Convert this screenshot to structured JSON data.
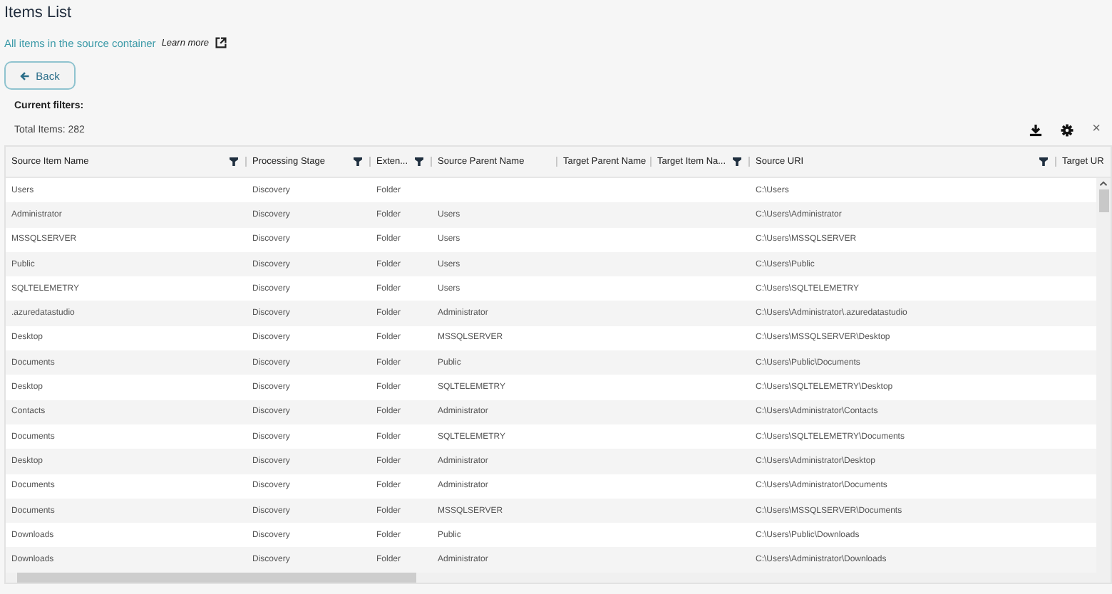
{
  "page": {
    "title": "Items List",
    "subtitle": "All items in the source container",
    "learn_more": "Learn more",
    "back_button": "Back",
    "filters_label": "Current filters:",
    "total_items": "Total Items: 282"
  },
  "toolbar": {
    "close": "×"
  },
  "table": {
    "columns": [
      {
        "label": "Source Item Name",
        "filterable": true
      },
      {
        "label": "Processing Stage",
        "filterable": true
      },
      {
        "label": "Exten...",
        "filterable": true
      },
      {
        "label": "Source Parent Name",
        "filterable": false
      },
      {
        "label": "Target Parent Name",
        "filterable": false
      },
      {
        "label": "Target Item Na...",
        "filterable": true
      },
      {
        "label": "Source URI",
        "filterable": true
      },
      {
        "label": "Target UR",
        "filterable": false
      }
    ],
    "rows": [
      [
        "Users",
        "Discovery",
        "Folder",
        "",
        "",
        "",
        "C:\\Users"
      ],
      [
        "Administrator",
        "Discovery",
        "Folder",
        "Users",
        "",
        "",
        "C:\\Users\\Administrator"
      ],
      [
        "MSSQLSERVER",
        "Discovery",
        "Folder",
        "Users",
        "",
        "",
        "C:\\Users\\MSSQLSERVER"
      ],
      [
        "Public",
        "Discovery",
        "Folder",
        "Users",
        "",
        "",
        "C:\\Users\\Public"
      ],
      [
        "SQLTELEMETRY",
        "Discovery",
        "Folder",
        "Users",
        "",
        "",
        "C:\\Users\\SQLTELEMETRY"
      ],
      [
        ".azuredatastudio",
        "Discovery",
        "Folder",
        "Administrator",
        "",
        "",
        "C:\\Users\\Administrator\\.azuredatastudio"
      ],
      [
        "Desktop",
        "Discovery",
        "Folder",
        "MSSQLSERVER",
        "",
        "",
        "C:\\Users\\MSSQLSERVER\\Desktop"
      ],
      [
        "Documents",
        "Discovery",
        "Folder",
        "Public",
        "",
        "",
        "C:\\Users\\Public\\Documents"
      ],
      [
        "Desktop",
        "Discovery",
        "Folder",
        "SQLTELEMETRY",
        "",
        "",
        "C:\\Users\\SQLTELEMETRY\\Desktop"
      ],
      [
        "Contacts",
        "Discovery",
        "Folder",
        "Administrator",
        "",
        "",
        "C:\\Users\\Administrator\\Contacts"
      ],
      [
        "Documents",
        "Discovery",
        "Folder",
        "SQLTELEMETRY",
        "",
        "",
        "C:\\Users\\SQLTELEMETRY\\Documents"
      ],
      [
        "Desktop",
        "Discovery",
        "Folder",
        "Administrator",
        "",
        "",
        "C:\\Users\\Administrator\\Desktop"
      ],
      [
        "Documents",
        "Discovery",
        "Folder",
        "Administrator",
        "",
        "",
        "C:\\Users\\Administrator\\Documents"
      ],
      [
        "Documents",
        "Discovery",
        "Folder",
        "MSSQLSERVER",
        "",
        "",
        "C:\\Users\\MSSQLSERVER\\Documents"
      ],
      [
        "Downloads",
        "Discovery",
        "Folder",
        "Public",
        "",
        "",
        "C:\\Users\\Public\\Downloads"
      ],
      [
        "Downloads",
        "Discovery",
        "Folder",
        "Administrator",
        "",
        "",
        "C:\\Users\\Administrator\\Downloads"
      ]
    ]
  }
}
